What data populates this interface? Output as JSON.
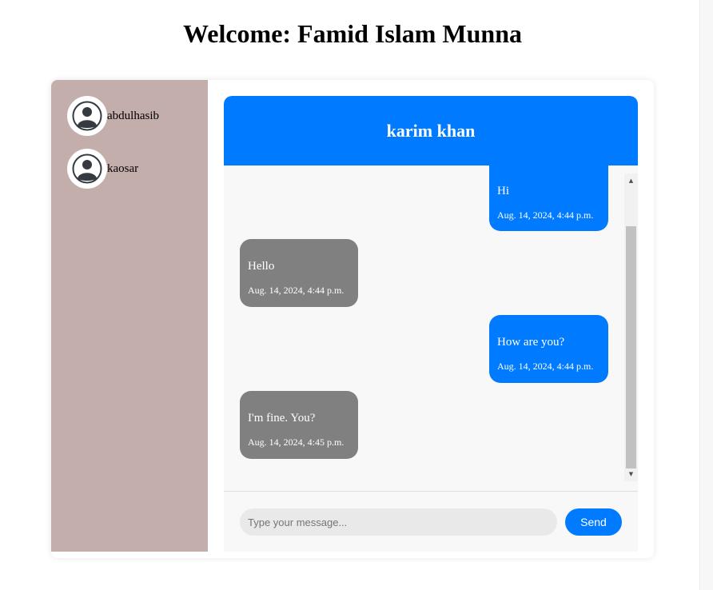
{
  "page": {
    "title": "Welcome: Famid Islam Munna"
  },
  "sidebar": {
    "contacts": [
      {
        "name": "abdulhasib",
        "icon": "user-avatar-icon"
      },
      {
        "name": "kaosar",
        "icon": "user-avatar-icon"
      }
    ]
  },
  "chat": {
    "header_title": "karim khan",
    "messages": [
      {
        "direction": "sent",
        "text": "Hi",
        "time": "Aug. 14, 2024, 4:44 p.m."
      },
      {
        "direction": "received",
        "text": "Hello",
        "time": "Aug. 14, 2024, 4:44 p.m."
      },
      {
        "direction": "sent",
        "text": "How are you?",
        "time": "Aug. 14, 2024, 4:44 p.m."
      },
      {
        "direction": "received",
        "text": "I'm fine. You?",
        "time": "Aug. 14, 2024, 4:45 p.m."
      }
    ],
    "input_placeholder": "Type your message...",
    "input_value": "",
    "send_label": "Send"
  },
  "colors": {
    "accent": "#007bff",
    "received_bubble": "#808080",
    "sidebar_bg": "#c4aeac"
  }
}
